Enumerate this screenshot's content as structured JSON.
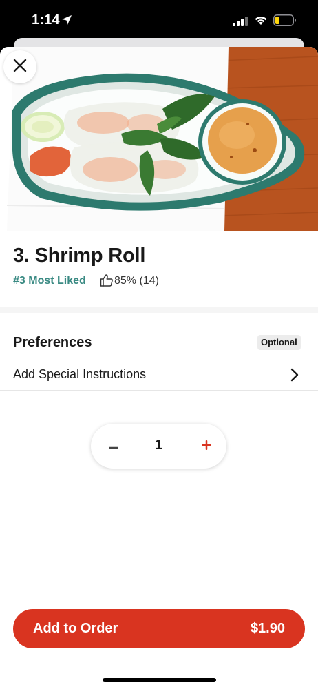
{
  "status_bar": {
    "time": "1:14",
    "location_icon": "location-arrow-icon",
    "signal_icon": "cellular-signal-icon",
    "wifi_icon": "wifi-icon",
    "battery_icon": "battery-low-icon",
    "battery_color": "#ffd60a"
  },
  "hero": {
    "image_description": "shrimp-spring-rolls-with-peanut-sauce",
    "close_icon": "close-icon"
  },
  "item": {
    "title": "3. Shrimp Roll",
    "rank_label": "#3 Most Liked",
    "like_icon": "thumbs-up-icon",
    "rating": "85% (14)"
  },
  "preferences": {
    "title": "Preferences",
    "optional_label": "Optional",
    "special_instructions_label": "Add Special Instructions",
    "chevron_icon": "chevron-right-icon"
  },
  "quantity": {
    "minus_icon": "minus-icon",
    "value": "1",
    "plus_icon": "plus-icon"
  },
  "footer": {
    "add_label": "Add to Order",
    "price": "$1.90",
    "accent_color": "#d93420"
  },
  "colors": {
    "rank_teal": "#3a8a83",
    "brand_red": "#d93420"
  }
}
